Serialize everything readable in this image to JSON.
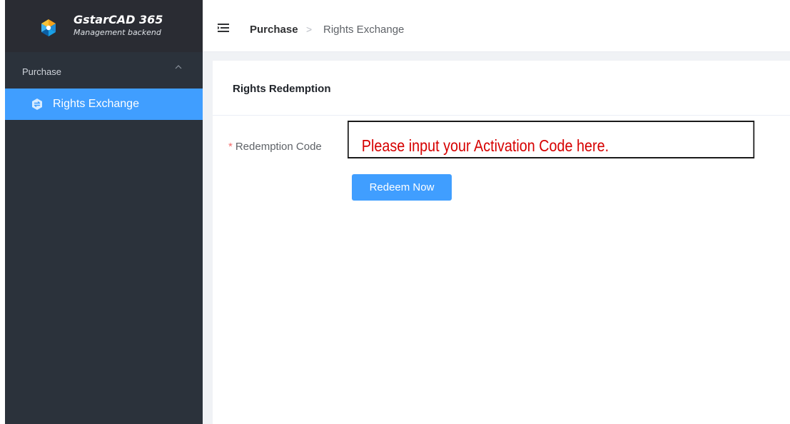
{
  "app": {
    "logo_title": "GstarCAD 365",
    "logo_subtitle": "Management backend",
    "logo_icon": "gstarcad-logo-icon"
  },
  "sidebar": {
    "group": {
      "label": "Purchase",
      "caret_icon": "chevron-up-icon"
    },
    "items": [
      {
        "label": "Rights Exchange",
        "icon": "exchange-icon",
        "active": true
      }
    ],
    "colors": {
      "background": "#2b323b",
      "active": "#409eff"
    }
  },
  "header": {
    "menu_icon": "hamburger-icon",
    "breadcrumb": {
      "root": "Purchase",
      "separator": ">",
      "current": "Rights Exchange"
    }
  },
  "card": {
    "title": "Rights Redemption",
    "form": {
      "label_required_mark": "*",
      "label": "Redemption Code",
      "input_value": "",
      "input_placeholder": "Please input your Activation Code here.",
      "button_label": "Redeem Now"
    }
  },
  "colors": {
    "accent": "#409eff",
    "annotation": "#d60000"
  }
}
